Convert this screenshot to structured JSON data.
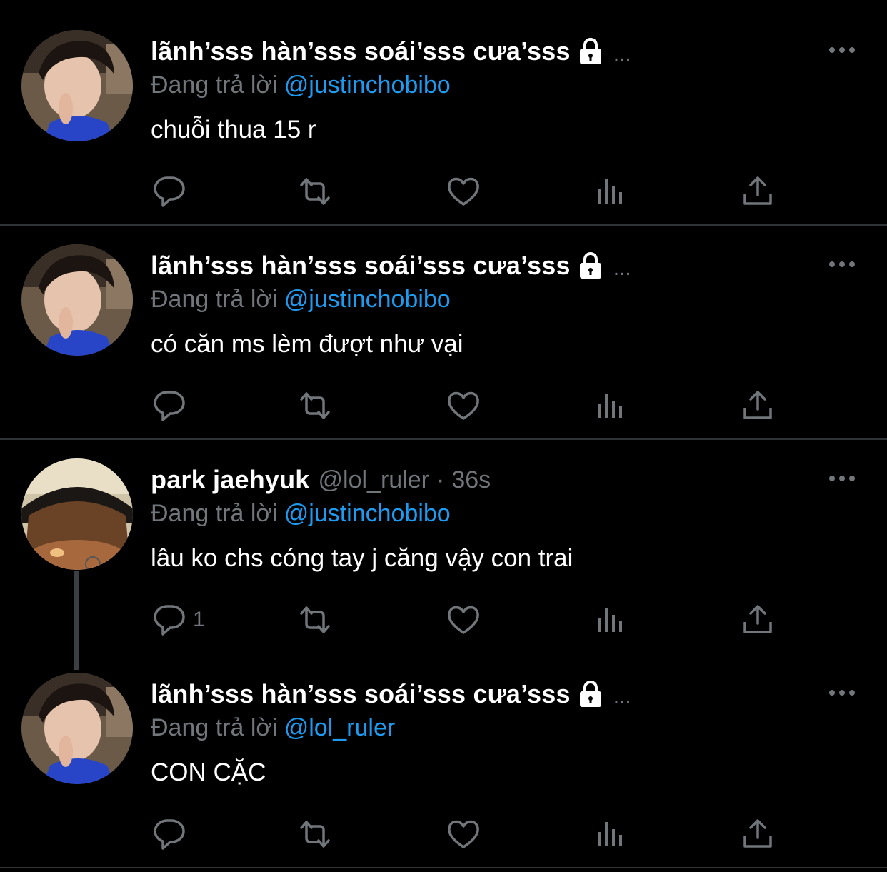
{
  "colors": {
    "background": "#000000",
    "accent": "#1d9bf0",
    "muted": "#71767b",
    "text": "#ffffff",
    "separator": "#2f3336"
  },
  "icons": {
    "reply": "reply-icon",
    "retweet": "retweet-icon",
    "like": "heart-icon",
    "views": "views-icon",
    "share": "share-icon",
    "more": "more-icon",
    "lock": "lock-icon"
  },
  "tweets": [
    {
      "display_name": "lãnh’sss hàn’sss soái’sss cưa’sss",
      "protected": true,
      "ellipsis": "...",
      "replying_prefix": "Đang trả lời",
      "replying_to": "@justinchobibo",
      "text": "chuỗi thua 15 r"
    },
    {
      "display_name": "lãnh’sss hàn’sss soái’sss cưa’sss",
      "protected": true,
      "ellipsis": "...",
      "replying_prefix": "Đang trả lời",
      "replying_to": "@justinchobibo",
      "text": "có căn ms lèm đượt như vại"
    },
    {
      "display_name": "park jaehyuk",
      "handle": "@lol_ruler",
      "separator": "·",
      "time": "36s",
      "replying_prefix": "Đang trả lời",
      "replying_to": "@justinchobibo",
      "text": "lâu ko chs cóng tay j căng vậy con trai",
      "reply_count": "1"
    },
    {
      "display_name": "lãnh’sss hàn’sss soái’sss cưa’sss",
      "protected": true,
      "ellipsis": "...",
      "replying_prefix": "Đang trả lời",
      "replying_to": "@lol_ruler",
      "text": "CON CẶC"
    }
  ]
}
